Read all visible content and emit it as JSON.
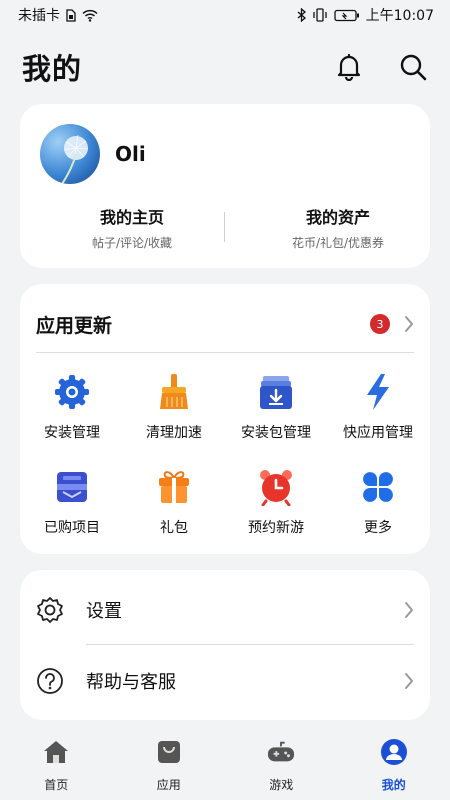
{
  "status_bar": {
    "carrier": "未插卡",
    "time": "上午10:07",
    "icons": [
      "sim-icon",
      "wifi-icon",
      "bluetooth-icon",
      "vibrate-icon",
      "battery-icon"
    ]
  },
  "header": {
    "title": "我的",
    "actions": [
      "bell-icon",
      "search-icon"
    ]
  },
  "profile": {
    "username": "Oli",
    "home_title": "我的主页",
    "home_sub": "帖子/评论/收藏",
    "assets_title": "我的资产",
    "assets_sub": "花币/礼包/优惠券"
  },
  "app_updates": {
    "title": "应用更新",
    "badge_count": "3",
    "items": [
      {
        "label": "安装管理",
        "icon": "gear-icon"
      },
      {
        "label": "清理加速",
        "icon": "broom-icon"
      },
      {
        "label": "安装包管理",
        "icon": "package-icon"
      },
      {
        "label": "快应用管理",
        "icon": "lightning-icon"
      },
      {
        "label": "已购项目",
        "icon": "purchased-icon"
      },
      {
        "label": "礼包",
        "icon": "gift-icon"
      },
      {
        "label": "预约新游",
        "icon": "alarm-clock-icon"
      },
      {
        "label": "更多",
        "icon": "more-grid-icon"
      }
    ]
  },
  "settings": [
    {
      "label": "设置",
      "icon": "settings-gear-icon"
    },
    {
      "label": "帮助与客服",
      "icon": "help-icon"
    }
  ],
  "bottom_nav": [
    {
      "label": "首页",
      "icon": "home-icon"
    },
    {
      "label": "应用",
      "icon": "app-bag-icon"
    },
    {
      "label": "游戏",
      "icon": "gamepad-icon"
    },
    {
      "label": "我的",
      "icon": "profile-icon",
      "active": true
    }
  ],
  "colors": {
    "accent": "#1a4fd6",
    "badge": "#d32b2b",
    "background": "#f1f3f5"
  }
}
